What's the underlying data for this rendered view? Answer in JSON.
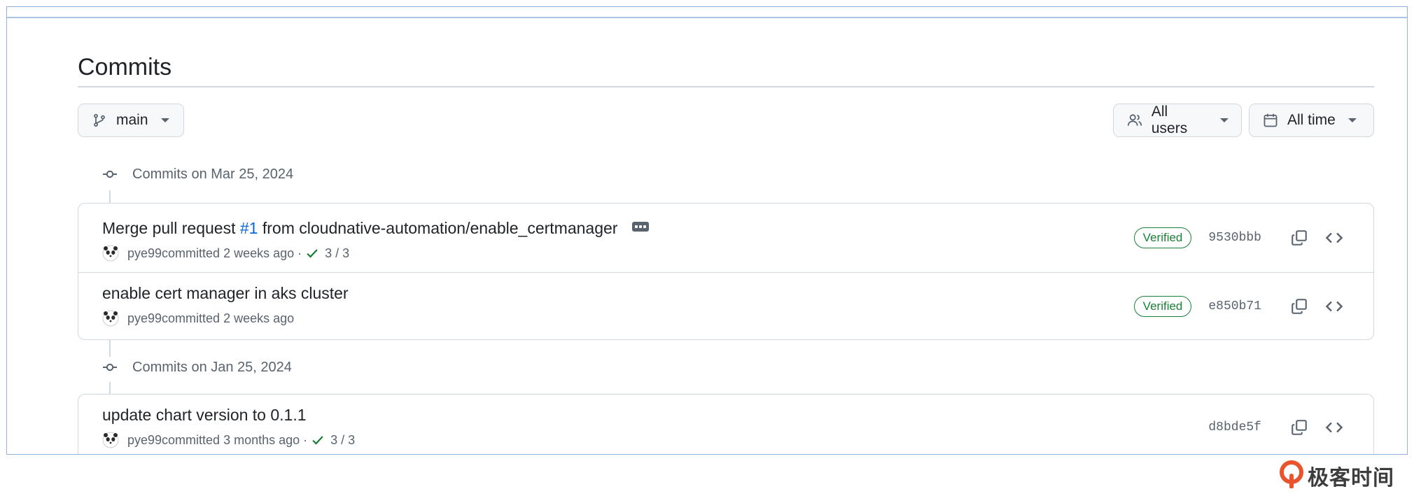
{
  "page": {
    "title": "Commits"
  },
  "filters": {
    "branch": {
      "label": "main",
      "icon": "git-branch-icon"
    },
    "users": {
      "label": "All users",
      "icon": "people-icon"
    },
    "time": {
      "label": "All time",
      "icon": "calendar-icon"
    }
  },
  "groups": [
    {
      "date_label": "Commits on Mar 25, 2024",
      "commits": [
        {
          "message_prefix": "Merge pull request ",
          "pr_link": "#1",
          "message_suffix": " from cloudnative-automation/enable_certmanager",
          "author": "pye99",
          "committed_text": " committed 2 weeks ago",
          "checks": "3 / 3",
          "verified": "Verified",
          "sha": "9530bbb"
        },
        {
          "message": "enable cert manager in aks cluster",
          "author": "pye99",
          "committed_text": " committed 2 weeks ago",
          "verified": "Verified",
          "sha": "e850b71"
        }
      ]
    },
    {
      "date_label": "Commits on Jan 25, 2024",
      "commits": [
        {
          "message": "update chart version to 0.1.1",
          "author": "pye99",
          "committed_text": " committed 3 months ago",
          "checks": "3 / 3",
          "sha": "d8bde5f"
        }
      ]
    }
  ],
  "colors": {
    "link": "#0969da",
    "verified": "#1a7f37",
    "muted": "#59636e",
    "border": "#d1d9e0",
    "watermark_accent": "#e8542e"
  },
  "watermark": {
    "text": "极客时间"
  }
}
